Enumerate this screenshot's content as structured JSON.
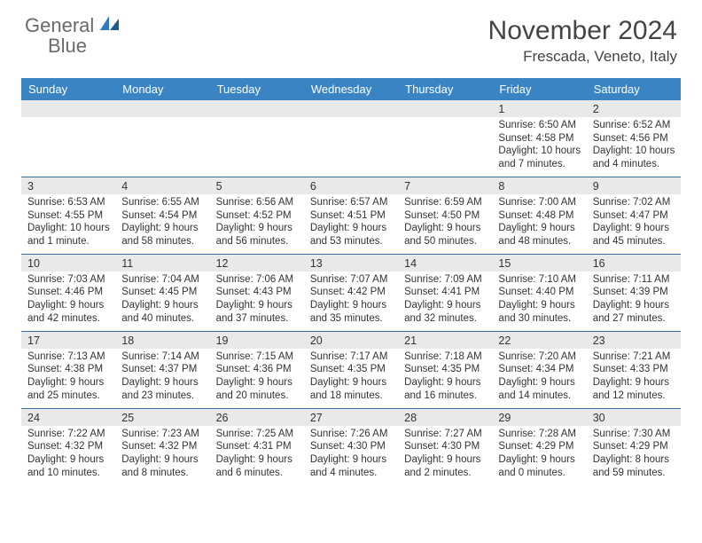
{
  "logo": {
    "word1": "General",
    "word2": "Blue"
  },
  "title": "November 2024",
  "location": "Frescada, Veneto, Italy",
  "day_headers": [
    "Sunday",
    "Monday",
    "Tuesday",
    "Wednesday",
    "Thursday",
    "Friday",
    "Saturday"
  ],
  "weeks": [
    [
      {
        "n": "",
        "sr": "",
        "ss": "",
        "dl": ""
      },
      {
        "n": "",
        "sr": "",
        "ss": "",
        "dl": ""
      },
      {
        "n": "",
        "sr": "",
        "ss": "",
        "dl": ""
      },
      {
        "n": "",
        "sr": "",
        "ss": "",
        "dl": ""
      },
      {
        "n": "",
        "sr": "",
        "ss": "",
        "dl": ""
      },
      {
        "n": "1",
        "sr": "Sunrise: 6:50 AM",
        "ss": "Sunset: 4:58 PM",
        "dl": "Daylight: 10 hours and 7 minutes."
      },
      {
        "n": "2",
        "sr": "Sunrise: 6:52 AM",
        "ss": "Sunset: 4:56 PM",
        "dl": "Daylight: 10 hours and 4 minutes."
      }
    ],
    [
      {
        "n": "3",
        "sr": "Sunrise: 6:53 AM",
        "ss": "Sunset: 4:55 PM",
        "dl": "Daylight: 10 hours and 1 minute."
      },
      {
        "n": "4",
        "sr": "Sunrise: 6:55 AM",
        "ss": "Sunset: 4:54 PM",
        "dl": "Daylight: 9 hours and 58 minutes."
      },
      {
        "n": "5",
        "sr": "Sunrise: 6:56 AM",
        "ss": "Sunset: 4:52 PM",
        "dl": "Daylight: 9 hours and 56 minutes."
      },
      {
        "n": "6",
        "sr": "Sunrise: 6:57 AM",
        "ss": "Sunset: 4:51 PM",
        "dl": "Daylight: 9 hours and 53 minutes."
      },
      {
        "n": "7",
        "sr": "Sunrise: 6:59 AM",
        "ss": "Sunset: 4:50 PM",
        "dl": "Daylight: 9 hours and 50 minutes."
      },
      {
        "n": "8",
        "sr": "Sunrise: 7:00 AM",
        "ss": "Sunset: 4:48 PM",
        "dl": "Daylight: 9 hours and 48 minutes."
      },
      {
        "n": "9",
        "sr": "Sunrise: 7:02 AM",
        "ss": "Sunset: 4:47 PM",
        "dl": "Daylight: 9 hours and 45 minutes."
      }
    ],
    [
      {
        "n": "10",
        "sr": "Sunrise: 7:03 AM",
        "ss": "Sunset: 4:46 PM",
        "dl": "Daylight: 9 hours and 42 minutes."
      },
      {
        "n": "11",
        "sr": "Sunrise: 7:04 AM",
        "ss": "Sunset: 4:45 PM",
        "dl": "Daylight: 9 hours and 40 minutes."
      },
      {
        "n": "12",
        "sr": "Sunrise: 7:06 AM",
        "ss": "Sunset: 4:43 PM",
        "dl": "Daylight: 9 hours and 37 minutes."
      },
      {
        "n": "13",
        "sr": "Sunrise: 7:07 AM",
        "ss": "Sunset: 4:42 PM",
        "dl": "Daylight: 9 hours and 35 minutes."
      },
      {
        "n": "14",
        "sr": "Sunrise: 7:09 AM",
        "ss": "Sunset: 4:41 PM",
        "dl": "Daylight: 9 hours and 32 minutes."
      },
      {
        "n": "15",
        "sr": "Sunrise: 7:10 AM",
        "ss": "Sunset: 4:40 PM",
        "dl": "Daylight: 9 hours and 30 minutes."
      },
      {
        "n": "16",
        "sr": "Sunrise: 7:11 AM",
        "ss": "Sunset: 4:39 PM",
        "dl": "Daylight: 9 hours and 27 minutes."
      }
    ],
    [
      {
        "n": "17",
        "sr": "Sunrise: 7:13 AM",
        "ss": "Sunset: 4:38 PM",
        "dl": "Daylight: 9 hours and 25 minutes."
      },
      {
        "n": "18",
        "sr": "Sunrise: 7:14 AM",
        "ss": "Sunset: 4:37 PM",
        "dl": "Daylight: 9 hours and 23 minutes."
      },
      {
        "n": "19",
        "sr": "Sunrise: 7:15 AM",
        "ss": "Sunset: 4:36 PM",
        "dl": "Daylight: 9 hours and 20 minutes."
      },
      {
        "n": "20",
        "sr": "Sunrise: 7:17 AM",
        "ss": "Sunset: 4:35 PM",
        "dl": "Daylight: 9 hours and 18 minutes."
      },
      {
        "n": "21",
        "sr": "Sunrise: 7:18 AM",
        "ss": "Sunset: 4:35 PM",
        "dl": "Daylight: 9 hours and 16 minutes."
      },
      {
        "n": "22",
        "sr": "Sunrise: 7:20 AM",
        "ss": "Sunset: 4:34 PM",
        "dl": "Daylight: 9 hours and 14 minutes."
      },
      {
        "n": "23",
        "sr": "Sunrise: 7:21 AM",
        "ss": "Sunset: 4:33 PM",
        "dl": "Daylight: 9 hours and 12 minutes."
      }
    ],
    [
      {
        "n": "24",
        "sr": "Sunrise: 7:22 AM",
        "ss": "Sunset: 4:32 PM",
        "dl": "Daylight: 9 hours and 10 minutes."
      },
      {
        "n": "25",
        "sr": "Sunrise: 7:23 AM",
        "ss": "Sunset: 4:32 PM",
        "dl": "Daylight: 9 hours and 8 minutes."
      },
      {
        "n": "26",
        "sr": "Sunrise: 7:25 AM",
        "ss": "Sunset: 4:31 PM",
        "dl": "Daylight: 9 hours and 6 minutes."
      },
      {
        "n": "27",
        "sr": "Sunrise: 7:26 AM",
        "ss": "Sunset: 4:30 PM",
        "dl": "Daylight: 9 hours and 4 minutes."
      },
      {
        "n": "28",
        "sr": "Sunrise: 7:27 AM",
        "ss": "Sunset: 4:30 PM",
        "dl": "Daylight: 9 hours and 2 minutes."
      },
      {
        "n": "29",
        "sr": "Sunrise: 7:28 AM",
        "ss": "Sunset: 4:29 PM",
        "dl": "Daylight: 9 hours and 0 minutes."
      },
      {
        "n": "30",
        "sr": "Sunrise: 7:30 AM",
        "ss": "Sunset: 4:29 PM",
        "dl": "Daylight: 8 hours and 59 minutes."
      }
    ]
  ]
}
